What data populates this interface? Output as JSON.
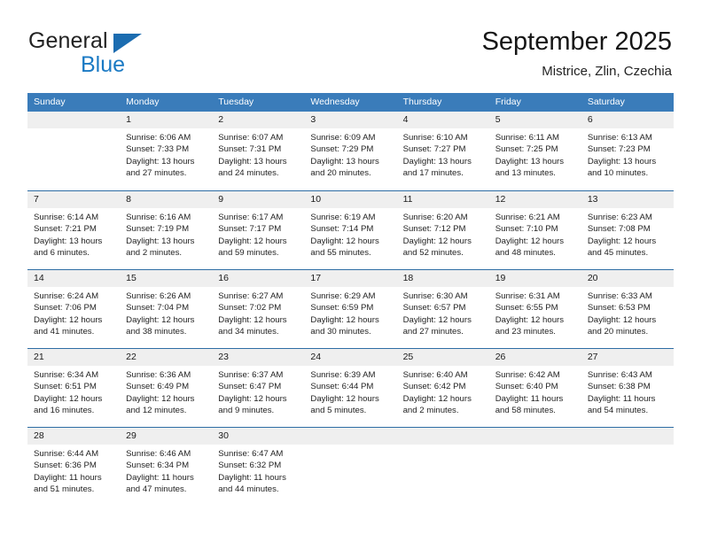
{
  "brand": {
    "word1": "General",
    "word2": "Blue",
    "triangle_color": "#1b6cb0",
    "blue_text_color": "#1b7ac4"
  },
  "header": {
    "title": "September 2025",
    "location": "Mistrice, Zlin, Czechia"
  },
  "theme": {
    "header_row_bg": "#3a7cba",
    "row_divider": "#2e6da4",
    "day_band_bg": "#efefef",
    "page_bg": "#ffffff"
  },
  "weekdays": [
    "Sunday",
    "Monday",
    "Tuesday",
    "Wednesday",
    "Thursday",
    "Friday",
    "Saturday"
  ],
  "weeks": [
    [
      {
        "day": "",
        "line1": "",
        "line2": "",
        "line3": "",
        "line4": "",
        "empty": true
      },
      {
        "day": "1",
        "line1": "Sunrise: 6:06 AM",
        "line2": "Sunset: 7:33 PM",
        "line3": "Daylight: 13 hours",
        "line4": "and 27 minutes."
      },
      {
        "day": "2",
        "line1": "Sunrise: 6:07 AM",
        "line2": "Sunset: 7:31 PM",
        "line3": "Daylight: 13 hours",
        "line4": "and 24 minutes."
      },
      {
        "day": "3",
        "line1": "Sunrise: 6:09 AM",
        "line2": "Sunset: 7:29 PM",
        "line3": "Daylight: 13 hours",
        "line4": "and 20 minutes."
      },
      {
        "day": "4",
        "line1": "Sunrise: 6:10 AM",
        "line2": "Sunset: 7:27 PM",
        "line3": "Daylight: 13 hours",
        "line4": "and 17 minutes."
      },
      {
        "day": "5",
        "line1": "Sunrise: 6:11 AM",
        "line2": "Sunset: 7:25 PM",
        "line3": "Daylight: 13 hours",
        "line4": "and 13 minutes."
      },
      {
        "day": "6",
        "line1": "Sunrise: 6:13 AM",
        "line2": "Sunset: 7:23 PM",
        "line3": "Daylight: 13 hours",
        "line4": "and 10 minutes."
      }
    ],
    [
      {
        "day": "7",
        "line1": "Sunrise: 6:14 AM",
        "line2": "Sunset: 7:21 PM",
        "line3": "Daylight: 13 hours",
        "line4": "and 6 minutes."
      },
      {
        "day": "8",
        "line1": "Sunrise: 6:16 AM",
        "line2": "Sunset: 7:19 PM",
        "line3": "Daylight: 13 hours",
        "line4": "and 2 minutes."
      },
      {
        "day": "9",
        "line1": "Sunrise: 6:17 AM",
        "line2": "Sunset: 7:17 PM",
        "line3": "Daylight: 12 hours",
        "line4": "and 59 minutes."
      },
      {
        "day": "10",
        "line1": "Sunrise: 6:19 AM",
        "line2": "Sunset: 7:14 PM",
        "line3": "Daylight: 12 hours",
        "line4": "and 55 minutes."
      },
      {
        "day": "11",
        "line1": "Sunrise: 6:20 AM",
        "line2": "Sunset: 7:12 PM",
        "line3": "Daylight: 12 hours",
        "line4": "and 52 minutes."
      },
      {
        "day": "12",
        "line1": "Sunrise: 6:21 AM",
        "line2": "Sunset: 7:10 PM",
        "line3": "Daylight: 12 hours",
        "line4": "and 48 minutes."
      },
      {
        "day": "13",
        "line1": "Sunrise: 6:23 AM",
        "line2": "Sunset: 7:08 PM",
        "line3": "Daylight: 12 hours",
        "line4": "and 45 minutes."
      }
    ],
    [
      {
        "day": "14",
        "line1": "Sunrise: 6:24 AM",
        "line2": "Sunset: 7:06 PM",
        "line3": "Daylight: 12 hours",
        "line4": "and 41 minutes."
      },
      {
        "day": "15",
        "line1": "Sunrise: 6:26 AM",
        "line2": "Sunset: 7:04 PM",
        "line3": "Daylight: 12 hours",
        "line4": "and 38 minutes."
      },
      {
        "day": "16",
        "line1": "Sunrise: 6:27 AM",
        "line2": "Sunset: 7:02 PM",
        "line3": "Daylight: 12 hours",
        "line4": "and 34 minutes."
      },
      {
        "day": "17",
        "line1": "Sunrise: 6:29 AM",
        "line2": "Sunset: 6:59 PM",
        "line3": "Daylight: 12 hours",
        "line4": "and 30 minutes."
      },
      {
        "day": "18",
        "line1": "Sunrise: 6:30 AM",
        "line2": "Sunset: 6:57 PM",
        "line3": "Daylight: 12 hours",
        "line4": "and 27 minutes."
      },
      {
        "day": "19",
        "line1": "Sunrise: 6:31 AM",
        "line2": "Sunset: 6:55 PM",
        "line3": "Daylight: 12 hours",
        "line4": "and 23 minutes."
      },
      {
        "day": "20",
        "line1": "Sunrise: 6:33 AM",
        "line2": "Sunset: 6:53 PM",
        "line3": "Daylight: 12 hours",
        "line4": "and 20 minutes."
      }
    ],
    [
      {
        "day": "21",
        "line1": "Sunrise: 6:34 AM",
        "line2": "Sunset: 6:51 PM",
        "line3": "Daylight: 12 hours",
        "line4": "and 16 minutes."
      },
      {
        "day": "22",
        "line1": "Sunrise: 6:36 AM",
        "line2": "Sunset: 6:49 PM",
        "line3": "Daylight: 12 hours",
        "line4": "and 12 minutes."
      },
      {
        "day": "23",
        "line1": "Sunrise: 6:37 AM",
        "line2": "Sunset: 6:47 PM",
        "line3": "Daylight: 12 hours",
        "line4": "and 9 minutes."
      },
      {
        "day": "24",
        "line1": "Sunrise: 6:39 AM",
        "line2": "Sunset: 6:44 PM",
        "line3": "Daylight: 12 hours",
        "line4": "and 5 minutes."
      },
      {
        "day": "25",
        "line1": "Sunrise: 6:40 AM",
        "line2": "Sunset: 6:42 PM",
        "line3": "Daylight: 12 hours",
        "line4": "and 2 minutes."
      },
      {
        "day": "26",
        "line1": "Sunrise: 6:42 AM",
        "line2": "Sunset: 6:40 PM",
        "line3": "Daylight: 11 hours",
        "line4": "and 58 minutes."
      },
      {
        "day": "27",
        "line1": "Sunrise: 6:43 AM",
        "line2": "Sunset: 6:38 PM",
        "line3": "Daylight: 11 hours",
        "line4": "and 54 minutes."
      }
    ],
    [
      {
        "day": "28",
        "line1": "Sunrise: 6:44 AM",
        "line2": "Sunset: 6:36 PM",
        "line3": "Daylight: 11 hours",
        "line4": "and 51 minutes."
      },
      {
        "day": "29",
        "line1": "Sunrise: 6:46 AM",
        "line2": "Sunset: 6:34 PM",
        "line3": "Daylight: 11 hours",
        "line4": "and 47 minutes."
      },
      {
        "day": "30",
        "line1": "Sunrise: 6:47 AM",
        "line2": "Sunset: 6:32 PM",
        "line3": "Daylight: 11 hours",
        "line4": "and 44 minutes."
      },
      {
        "day": "",
        "line1": "",
        "line2": "",
        "line3": "",
        "line4": "",
        "empty": true
      },
      {
        "day": "",
        "line1": "",
        "line2": "",
        "line3": "",
        "line4": "",
        "empty": true
      },
      {
        "day": "",
        "line1": "",
        "line2": "",
        "line3": "",
        "line4": "",
        "empty": true
      },
      {
        "day": "",
        "line1": "",
        "line2": "",
        "line3": "",
        "line4": "",
        "empty": true
      }
    ]
  ]
}
